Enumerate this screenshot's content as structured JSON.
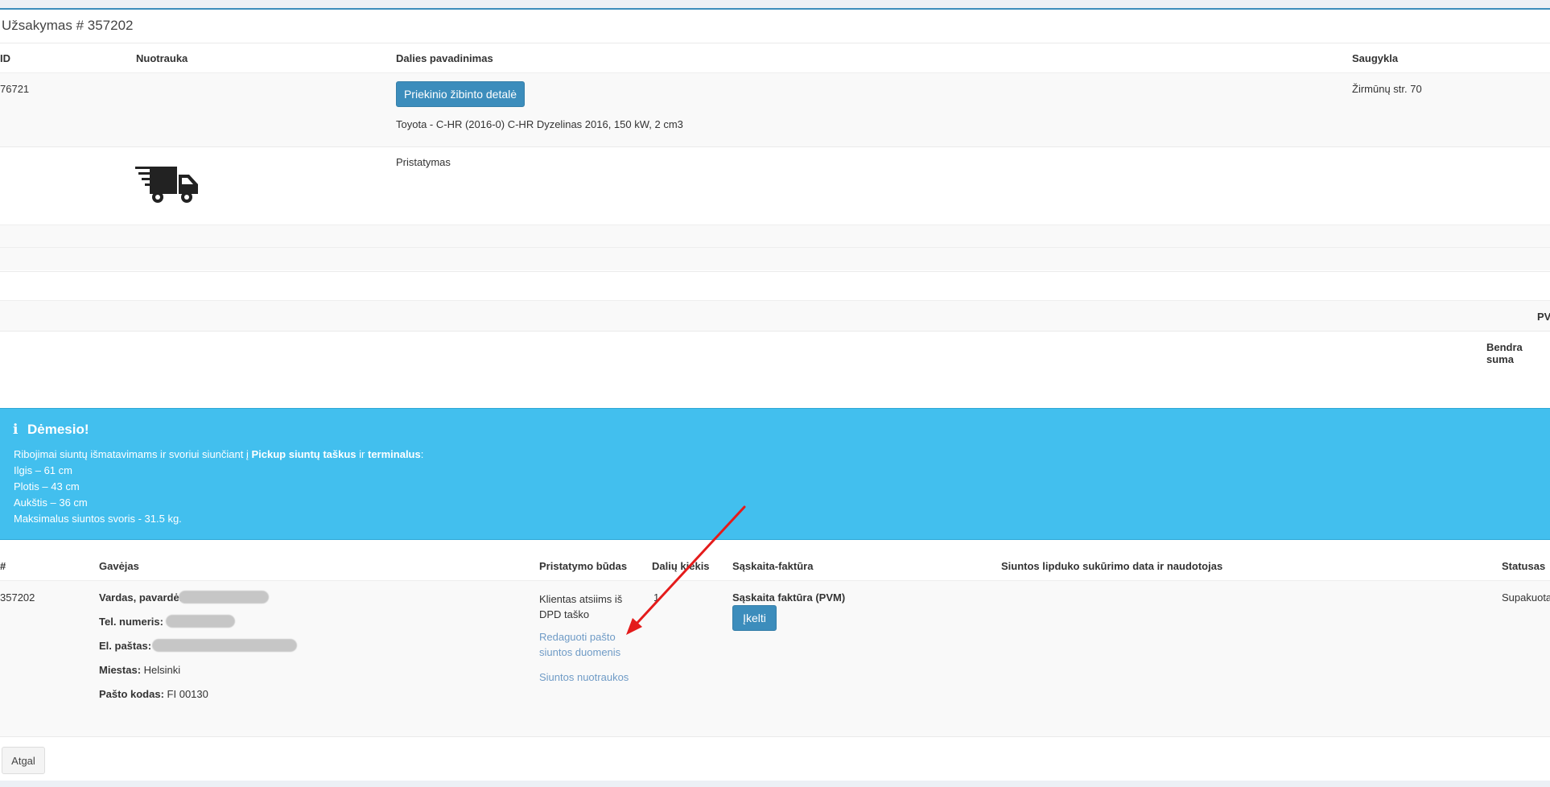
{
  "order": {
    "title": "Užsakymas # 357202"
  },
  "parts_table": {
    "headers": {
      "id": "ID",
      "photo": "Nuotrauka",
      "name": "Dalies pavadinimas",
      "storage": "Saugykla"
    },
    "row1": {
      "id": "76721",
      "part_button": "Priekinio žibinto detalė",
      "vehicle": "Toyota - C-HR (2016-0) C-HR Dyzelinas 2016, 150 kW, 2 cm3",
      "storage": "Žirmūnų str. 70"
    },
    "row2": {
      "name": "Pristatymas",
      "icon": "delivery-truck-icon"
    },
    "totals": {
      "vat": "PV",
      "total": "Bendra suma"
    }
  },
  "notice": {
    "title": "Dėmesio!",
    "icon": "info-icon",
    "intro_pre": "Ribojimai siuntų išmatavimams ir svoriui siunčiant į ",
    "intro_bold1": "Pickup siuntų taškus",
    "intro_mid": " ir ",
    "intro_bold2": "terminalus",
    "intro_post": ":",
    "length": "Ilgis – 61 cm",
    "width": "Plotis – 43 cm",
    "height": "Aukštis – 36 cm",
    "weight": "Maksimalus siuntos svoris - 31.5 kg."
  },
  "shipment_table": {
    "headers": {
      "num": "#",
      "recipient": "Gavėjas",
      "method": "Pristatymo būdas",
      "qty": "Dalių kiekis",
      "invoice": "Sąskaita-faktūra",
      "label_date": "Siuntos lipduko sukūrimo data ir naudotojas",
      "status": "Statusas"
    },
    "row": {
      "num": "357202",
      "name_label": "Vardas, pavardė:",
      "phone_label": "Tel. numeris:",
      "email_label": "El. paštas:",
      "city_label": "Miestas:",
      "city": "Helsinki",
      "postal_label": "Pašto kodas:",
      "postal": "FI 00130",
      "method_line1": "Klientas atsiims iš",
      "method_line2": "DPD taško",
      "edit_link_line1": "Redaguoti pašto",
      "edit_link_line2": "siuntos duomenis",
      "photos_link": "Siuntos nuotraukos",
      "qty": "1",
      "invoice_title": "Sąskaita faktūra (PVM)",
      "upload_button": "Įkelti",
      "status": "Supakuota"
    }
  },
  "footer": {
    "back_button": "Atgal"
  },
  "colors": {
    "accent": "#3c8dbc",
    "callout": "#42bfee",
    "annotation_arrow": "#e41b1b"
  }
}
